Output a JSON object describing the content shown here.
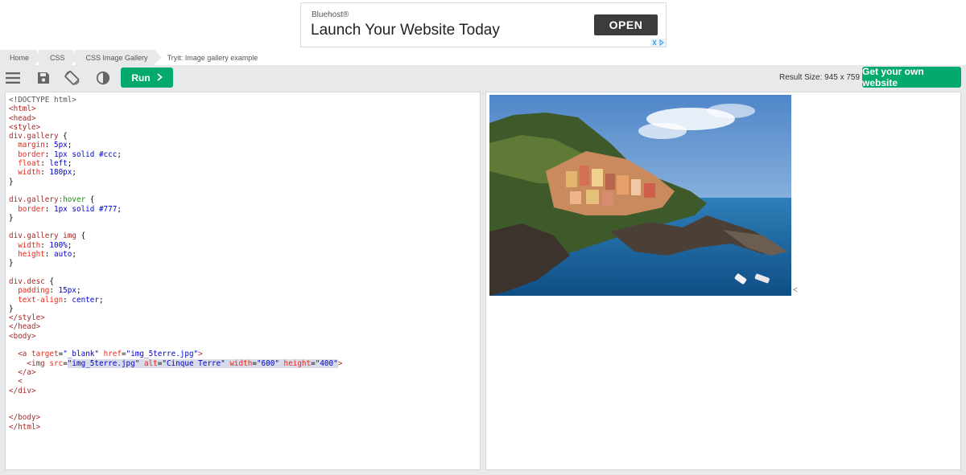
{
  "ad": {
    "brand": "Bluehost®",
    "headline": "Launch Your Website Today",
    "cta": "OPEN"
  },
  "breadcrumb": [
    {
      "label": "Home"
    },
    {
      "label": "CSS"
    },
    {
      "label": "CSS Image Gallery"
    },
    {
      "label": "Tryit: Image gallery example"
    }
  ],
  "toolbar": {
    "menu_icon": "hamburger-menu-icon",
    "save_icon": "save-icon",
    "rotate_icon": "rotate-orientation-icon",
    "theme_icon": "contrast-icon",
    "run_label": "Run",
    "result_size": "Result Size: 945 x 759",
    "get_website_label": "Get your own website"
  },
  "colors": {
    "accent": "#04aa6d",
    "toolbar_bg": "#e7e9eb"
  },
  "code_lines": [
    [
      {
        "t": "<!DOCTYPE html>",
        "c": "t-doc"
      }
    ],
    [
      {
        "t": "<html>",
        "c": "t-tag"
      }
    ],
    [
      {
        "t": "<head>",
        "c": "t-tag"
      }
    ],
    [
      {
        "t": "<style>",
        "c": "t-tag"
      }
    ],
    [
      {
        "t": "div.gallery ",
        "c": "t-sel"
      },
      {
        "t": "{",
        "c": ""
      }
    ],
    [
      {
        "t": "  margin",
        "c": "t-prop"
      },
      {
        "t": ": ",
        "c": ""
      },
      {
        "t": "5px",
        "c": "t-val"
      },
      {
        "t": ";",
        "c": ""
      }
    ],
    [
      {
        "t": "  border",
        "c": "t-prop"
      },
      {
        "t": ": ",
        "c": ""
      },
      {
        "t": "1px solid #ccc",
        "c": "t-val"
      },
      {
        "t": ";",
        "c": ""
      }
    ],
    [
      {
        "t": "  float",
        "c": "t-prop"
      },
      {
        "t": ": ",
        "c": ""
      },
      {
        "t": "left",
        "c": "t-val"
      },
      {
        "t": ";",
        "c": ""
      }
    ],
    [
      {
        "t": "  width",
        "c": "t-prop"
      },
      {
        "t": ": ",
        "c": ""
      },
      {
        "t": "180px",
        "c": "t-val"
      },
      {
        "t": ";",
        "c": ""
      }
    ],
    [
      {
        "t": "}",
        "c": ""
      }
    ],
    [
      {
        "t": "",
        "c": ""
      }
    ],
    [
      {
        "t": "div.gallery",
        "c": "t-sel"
      },
      {
        "t": ":hover",
        "c": "t-pseudo"
      },
      {
        "t": " {",
        "c": ""
      }
    ],
    [
      {
        "t": "  border",
        "c": "t-prop"
      },
      {
        "t": ": ",
        "c": ""
      },
      {
        "t": "1px solid #777",
        "c": "t-val"
      },
      {
        "t": ";",
        "c": ""
      }
    ],
    [
      {
        "t": "}",
        "c": ""
      }
    ],
    [
      {
        "t": "",
        "c": ""
      }
    ],
    [
      {
        "t": "div.gallery img ",
        "c": "t-sel"
      },
      {
        "t": "{",
        "c": ""
      }
    ],
    [
      {
        "t": "  width",
        "c": "t-prop"
      },
      {
        "t": ": ",
        "c": ""
      },
      {
        "t": "100%",
        "c": "t-val"
      },
      {
        "t": ";",
        "c": ""
      }
    ],
    [
      {
        "t": "  height",
        "c": "t-prop"
      },
      {
        "t": ": ",
        "c": ""
      },
      {
        "t": "auto",
        "c": "t-val"
      },
      {
        "t": ";",
        "c": ""
      }
    ],
    [
      {
        "t": "}",
        "c": ""
      }
    ],
    [
      {
        "t": "",
        "c": ""
      }
    ],
    [
      {
        "t": "div.desc ",
        "c": "t-sel"
      },
      {
        "t": "{",
        "c": ""
      }
    ],
    [
      {
        "t": "  padding",
        "c": "t-prop"
      },
      {
        "t": ": ",
        "c": ""
      },
      {
        "t": "15px",
        "c": "t-val"
      },
      {
        "t": ";",
        "c": ""
      }
    ],
    [
      {
        "t": "  text-align",
        "c": "t-prop"
      },
      {
        "t": ": ",
        "c": ""
      },
      {
        "t": "center",
        "c": "t-val"
      },
      {
        "t": ";",
        "c": ""
      }
    ],
    [
      {
        "t": "}",
        "c": ""
      }
    ],
    [
      {
        "t": "</style>",
        "c": "t-tag"
      }
    ],
    [
      {
        "t": "</head>",
        "c": "t-tag"
      }
    ],
    [
      {
        "t": "<body>",
        "c": "t-tag"
      }
    ],
    [
      {
        "t": "",
        "c": ""
      }
    ],
    [
      {
        "t": "  ",
        "c": ""
      },
      {
        "t": "<a ",
        "c": "t-tag"
      },
      {
        "t": "target",
        "c": "t-attr"
      },
      {
        "t": "=",
        "c": ""
      },
      {
        "t": "\"_blank\"",
        "c": "t-str"
      },
      {
        "t": " href",
        "c": "t-attr"
      },
      {
        "t": "=",
        "c": ""
      },
      {
        "t": "\"img_5terre.jpg\"",
        "c": "t-str"
      },
      {
        "t": ">",
        "c": "t-tag"
      }
    ],
    [
      {
        "t": "    ",
        "c": ""
      },
      {
        "t": "<img ",
        "c": "t-tag"
      },
      {
        "t": "src",
        "c": "t-attr"
      },
      {
        "t": "=",
        "c": ""
      },
      {
        "t": "\"img_5terre.jpg\"",
        "c": "t-str hl"
      },
      {
        "t": " alt",
        "c": "t-attr hl"
      },
      {
        "t": "=",
        "c": "hl"
      },
      {
        "t": "\"Cinque Terre\"",
        "c": "t-str hl"
      },
      {
        "t": " width",
        "c": "t-attr hl"
      },
      {
        "t": "=",
        "c": "hl"
      },
      {
        "t": "\"600\"",
        "c": "t-str hl"
      },
      {
        "t": " height",
        "c": "t-attr hl"
      },
      {
        "t": "=",
        "c": "hl"
      },
      {
        "t": "\"400\"",
        "c": "t-str hl"
      },
      {
        "t": ">",
        "c": "t-tag"
      }
    ],
    [
      {
        "t": "  ",
        "c": ""
      },
      {
        "t": "</a>",
        "c": "t-tag"
      }
    ],
    [
      {
        "t": "  ",
        "c": ""
      },
      {
        "t": "<",
        "c": "t-tag"
      }
    ],
    [
      {
        "t": "</div>",
        "c": "t-tag"
      }
    ],
    [
      {
        "t": "",
        "c": ""
      }
    ],
    [
      {
        "t": "",
        "c": ""
      }
    ],
    [
      {
        "t": "</body>",
        "c": "t-tag"
      }
    ],
    [
      {
        "t": "</html>",
        "c": "t-tag"
      }
    ]
  ],
  "result": {
    "image_alt": "Cinque Terre",
    "trailing_text": "<"
  }
}
